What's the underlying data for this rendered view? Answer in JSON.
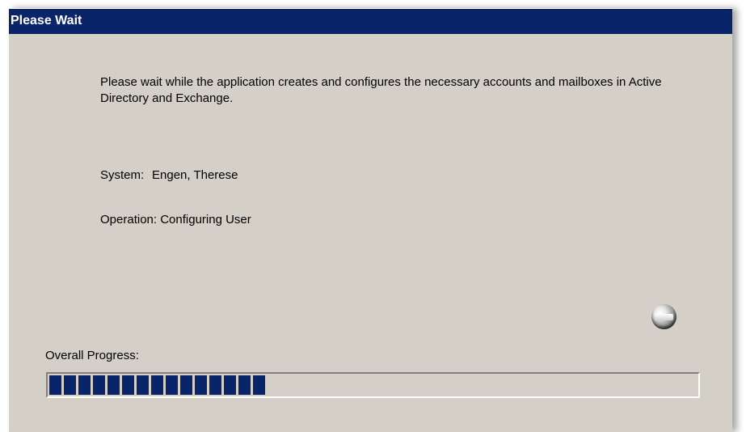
{
  "window": {
    "title": "Please Wait"
  },
  "message": "Please wait while the application creates and configures the necessary accounts and mailboxes in Active Directory and Exchange.",
  "status": {
    "system_label": "System:",
    "system_value": "Engen, Therese",
    "operation_label": "Operation:",
    "operation_value": "Configuring User"
  },
  "progress": {
    "label": "Overall Progress:",
    "fraction": 0.32
  },
  "colors": {
    "titlebar": "#0a246a",
    "dialog_background": "#d4d0c8",
    "progress_fill": "#0a246a"
  },
  "icons": {
    "busy_indicator": "spinner-icon"
  }
}
